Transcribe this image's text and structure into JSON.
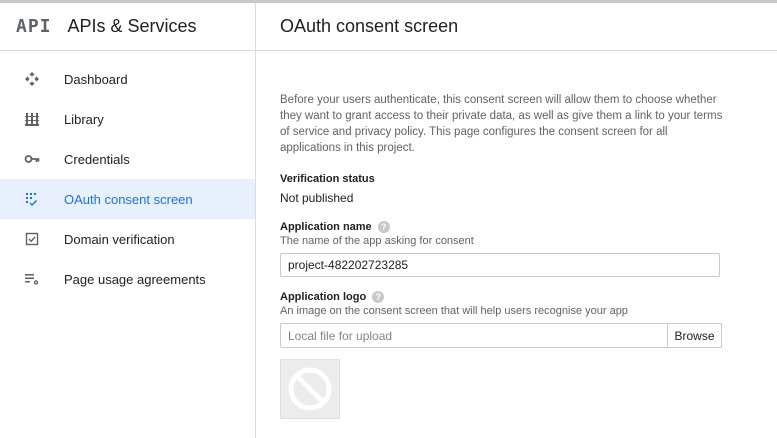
{
  "sidebar": {
    "logo": "API",
    "title": "APIs & Services",
    "items": [
      {
        "label": "Dashboard",
        "icon": "dashboard-icon"
      },
      {
        "label": "Library",
        "icon": "library-icon"
      },
      {
        "label": "Credentials",
        "icon": "key-icon"
      },
      {
        "label": "OAuth consent screen",
        "icon": "consent-icon",
        "active": true
      },
      {
        "label": "Domain verification",
        "icon": "checkbox-icon"
      },
      {
        "label": "Page usage agreements",
        "icon": "settings-list-icon"
      }
    ]
  },
  "main": {
    "title": "OAuth consent screen",
    "description": "Before your users authenticate, this consent screen will allow them to choose whether they want to grant access to their private data, as well as give them a link to your terms of service and privacy policy. This page configures the consent screen for all applications in this project.",
    "verification": {
      "label": "Verification status",
      "value": "Not published"
    },
    "app_name": {
      "label": "Application name",
      "hint": "The name of the app asking for consent",
      "value": "project-482202723285"
    },
    "app_logo": {
      "label": "Application logo",
      "hint": "An image on the consent screen that will help users recognise your app",
      "placeholder": "Local file for upload",
      "browse_label": "Browse"
    }
  },
  "colors": {
    "accent": "#1a73e8",
    "active_bg": "#e8f0fe"
  }
}
